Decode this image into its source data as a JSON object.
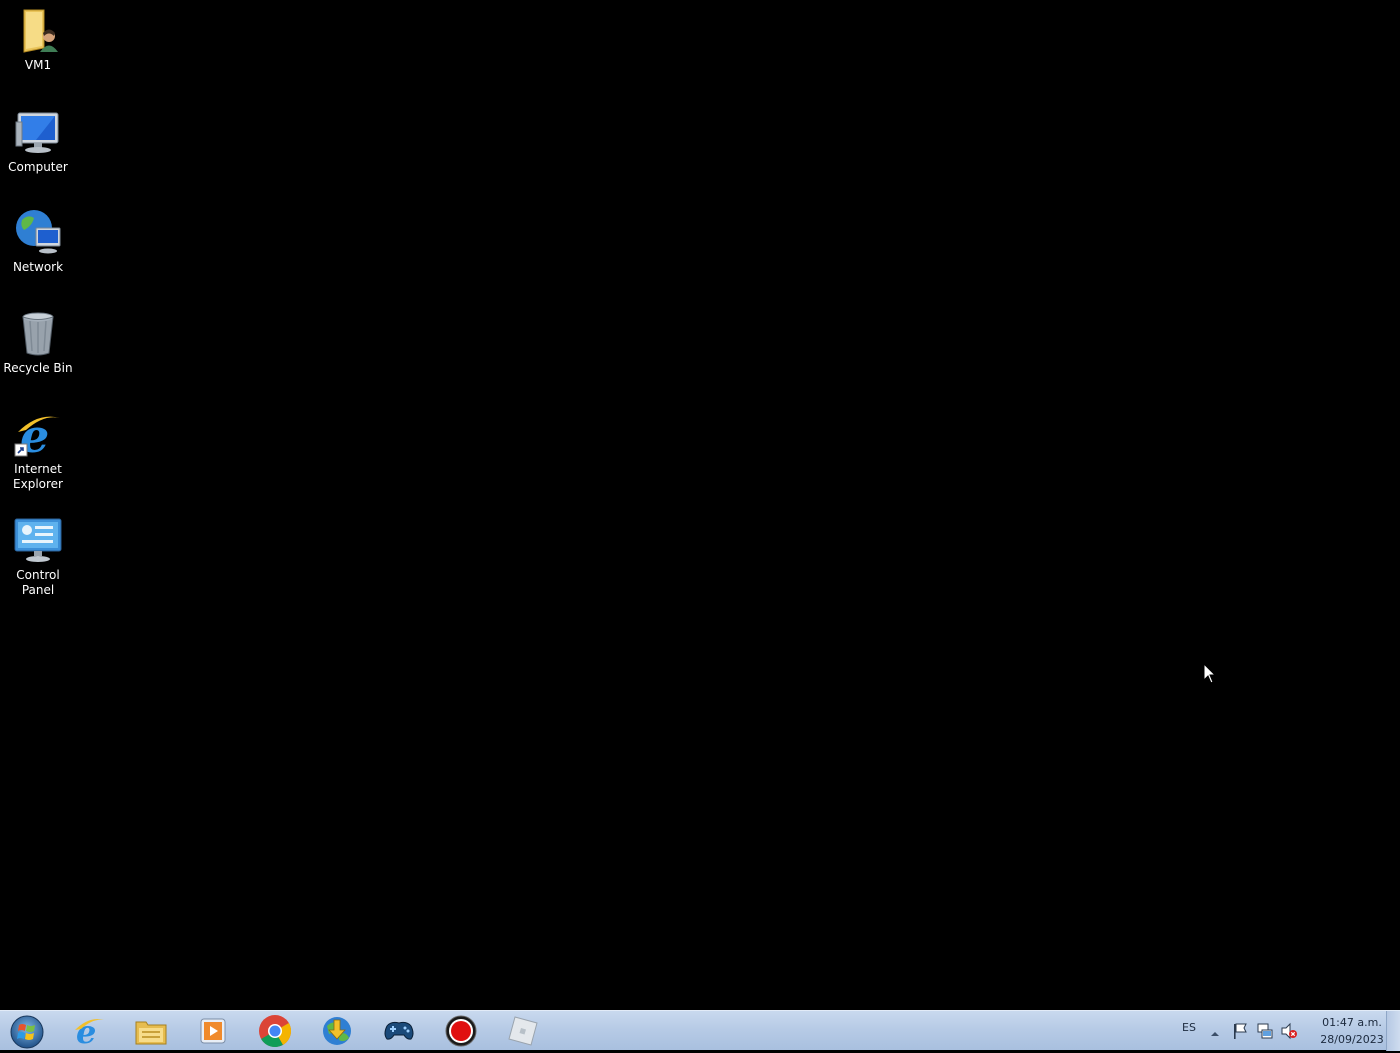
{
  "desktop": {
    "icons": [
      {
        "label": "VM1",
        "icon": "user-folder-icon"
      },
      {
        "label": "Computer",
        "icon": "computer-icon"
      },
      {
        "label": "Network",
        "icon": "network-icon"
      },
      {
        "label": "Recycle Bin",
        "icon": "recycle-bin-icon"
      },
      {
        "label": "Internet\nExplorer",
        "icon": "internet-explorer-icon"
      },
      {
        "label": "Control Panel",
        "icon": "control-panel-icon"
      }
    ]
  },
  "taskbar": {
    "start": {
      "icon": "windows-start-icon"
    },
    "pinned": [
      {
        "icon": "internet-explorer-icon"
      },
      {
        "icon": "file-explorer-icon"
      },
      {
        "icon": "media-player-icon"
      },
      {
        "icon": "chrome-icon"
      },
      {
        "icon": "download-manager-icon"
      },
      {
        "icon": "game-controller-icon"
      },
      {
        "icon": "record-icon"
      },
      {
        "icon": "roblox-icon"
      }
    ],
    "tray": {
      "language": "ES",
      "time": "01:47 a.m.",
      "date": "28/09/2023",
      "icons": [
        "show-hidden-icons-icon",
        "action-center-flag-icon",
        "network-tray-icon",
        "volume-muted-icon"
      ]
    }
  },
  "colors": {
    "desktop_bg": "#000000",
    "taskbar_top": "#c9d9ee",
    "taskbar_bottom": "#a9c0df"
  }
}
